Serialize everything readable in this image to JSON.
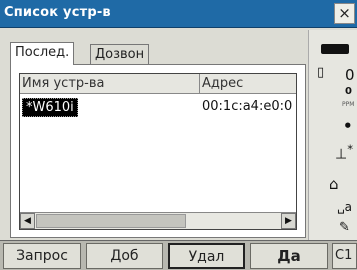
{
  "window": {
    "title": "Список устр-в",
    "close_label": "×"
  },
  "tabs": [
    {
      "label": "Послед.",
      "active": true
    },
    {
      "label": "Дозвон",
      "active": false
    }
  ],
  "device_list": {
    "columns": [
      "Имя устр-ва",
      "Адрес"
    ],
    "rows": [
      {
        "name": "*W610i",
        "address": "00:1c:a4:e0:0",
        "selected": true
      }
    ]
  },
  "scrollbar": {
    "left_arrow": "◀",
    "right_arrow": "▶"
  },
  "status_panel": {
    "battery_icon": "battery-icon",
    "disk_glyph": "▯",
    "prism_constant": "0",
    "ppm_value": "0",
    "ppm_label": "PPM",
    "dot_glyph": "•",
    "target_glyph": "⊥",
    "target_mark": "*",
    "plumb_glyph": "⌂",
    "input_mode": "␣a",
    "edit_glyph": "✎"
  },
  "softkeys": [
    "Запрос",
    "Доб",
    "Удал",
    "Да",
    "C1"
  ],
  "colors": {
    "titlebar": "#1f6aa6",
    "background": "#dcdcd4",
    "softkey_bar": "#b8b8b0"
  }
}
